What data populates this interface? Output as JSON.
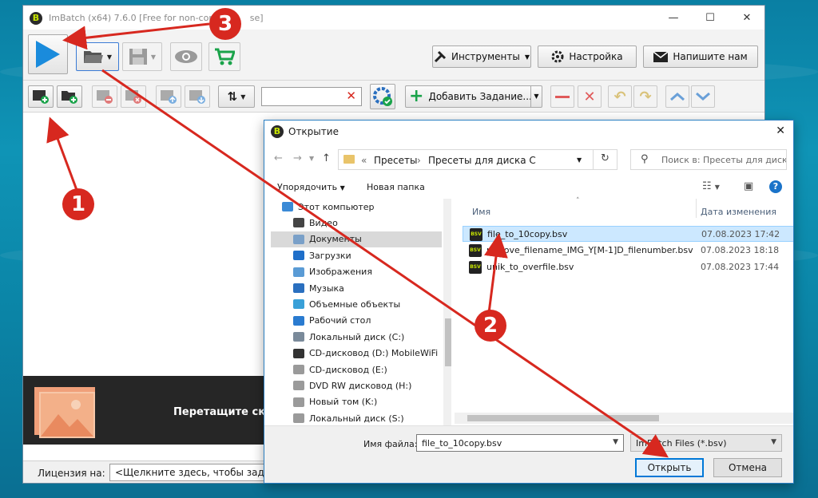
{
  "main_window": {
    "logo": "B",
    "title": "ImBatch (x64) 7.6.0 [Free for non-comm",
    "title_tail": "se]",
    "controls": {
      "minimize": "—",
      "maximize": "☐",
      "close": "✕"
    },
    "toolbar": {
      "tools_label": "Инструменты",
      "settings_label": "Настройка",
      "write_us_label": "Напишите нам",
      "add_task_label": "Добавить Задание..."
    },
    "drop_text": "Перетащите ск",
    "license_label": "Лицензия на:",
    "license_value": "<Щелкните здесь, чтобы задат"
  },
  "open_dialog": {
    "logo": "B",
    "title": "Открытие",
    "close": "✕",
    "path": {
      "prefix": "«",
      "segment1": "Пресеты",
      "separator": "›",
      "segment2": "Пресеты для диска C"
    },
    "search_placeholder": "Поиск в: Пресеты для диск...",
    "organize_label": "Упорядочить",
    "new_folder_label": "Новая папка",
    "nav_items": [
      {
        "label": "Этот компьютер",
        "color": "#3a8ad6"
      },
      {
        "label": "Видео",
        "color": "#444444"
      },
      {
        "label": "Документы",
        "color": "#7aa0c8",
        "selected": true
      },
      {
        "label": "Загрузки",
        "color": "#1f6fc9"
      },
      {
        "label": "Изображения",
        "color": "#5a9bd5"
      },
      {
        "label": "Музыка",
        "color": "#2a6fbf"
      },
      {
        "label": "Объемные объекты",
        "color": "#39a0d8"
      },
      {
        "label": "Рабочий стол",
        "color": "#2a7bd0"
      },
      {
        "label": "Локальный диск (C:)",
        "color": "#7a8a9a"
      },
      {
        "label": "CD-дисковод (D:) MobileWiFi",
        "color": "#333333"
      },
      {
        "label": "CD-дисковод (E:)",
        "color": "#9a9a9a"
      },
      {
        "label": "DVD RW дисковод (H:)",
        "color": "#9a9a9a"
      },
      {
        "label": "Новый том (K:)",
        "color": "#9a9a9a"
      },
      {
        "label": "Локальный диск (S:)",
        "color": "#9a9a9a"
      }
    ],
    "columns": {
      "name": "Имя",
      "date": "Дата изменения"
    },
    "files": [
      {
        "name": "file_to_10copy.bsv",
        "date": "07.08.2023 17:42",
        "selected": true
      },
      {
        "name": "remove_filename_IMG_Y[M-1]D_filenumber.bsv",
        "date": "07.08.2023 18:18"
      },
      {
        "name": "unik_to_overfile.bsv",
        "date": "07.08.2023 17:44"
      }
    ],
    "file_icon_text": "BSV",
    "filename_label": "Имя файла:",
    "filename_value": "file_to_10copy.bsv",
    "filetype_value": "ImBatch Files (*.bsv)",
    "open_label": "Открыть",
    "cancel_label": "Отмена"
  },
  "annotations": {
    "badge1": "1",
    "badge2": "2",
    "badge3": "3",
    "color": "#d7281f"
  }
}
